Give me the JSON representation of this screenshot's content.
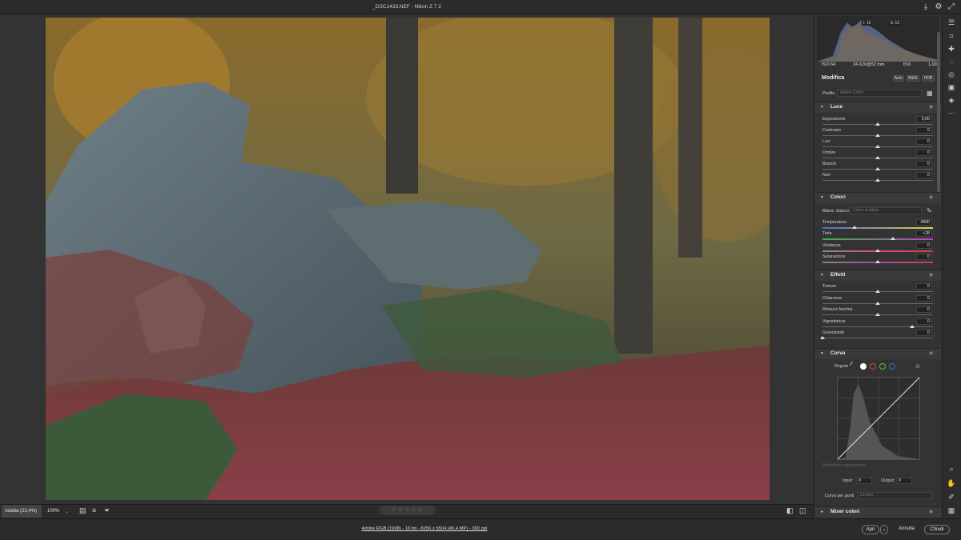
{
  "window": {
    "title": "_DSC1433.NEF  -  Nikon Z 7 2"
  },
  "histogram": {
    "labels": [
      "i: 16",
      "b: 12"
    ]
  },
  "camera": {
    "iso": "ISO 64",
    "lens": "24-120@52 mm",
    "aperture": "f/16",
    "shutter": "1,00s"
  },
  "edit": {
    "title": "Modifica",
    "buttons": [
      "Auto",
      "B&W",
      "HDR"
    ],
    "profile_label": "Profilo",
    "profile_value": "Adobe Colori"
  },
  "light": {
    "title": "Luce",
    "sliders": [
      {
        "label": "Esposizione",
        "value": "0,00"
      },
      {
        "label": "Contrasto",
        "value": "0"
      },
      {
        "label": "Luci",
        "value": "0"
      },
      {
        "label": "Ombre",
        "value": "0"
      },
      {
        "label": "Bianchi",
        "value": "0"
      },
      {
        "label": "Neri",
        "value": "0"
      }
    ]
  },
  "colors": {
    "title": "Colori",
    "wb_label": "Bilanc. bianco",
    "wb_value": "Come scattata",
    "sliders": [
      {
        "label": "Temperatura",
        "value": "4900"
      },
      {
        "label": "Tinta",
        "value": "+28"
      },
      {
        "label": "Vividezza",
        "value": "0"
      },
      {
        "label": "Saturazione",
        "value": "0"
      }
    ]
  },
  "effects": {
    "title": "Effetti",
    "sliders": [
      {
        "label": "Texture",
        "value": "0"
      },
      {
        "label": "Chiarezza",
        "value": "0"
      },
      {
        "label": "Rimuovi foschia",
        "value": "0"
      },
      {
        "label": "Vignettatura",
        "value": "0"
      },
      {
        "label": "Granulosità",
        "value": "0"
      }
    ]
  },
  "curve": {
    "title": "Curva",
    "regola_label": "Regola",
    "refine_label": "Perfeziona saturazione",
    "input_label": "Input:",
    "input_value": "0",
    "output_label": "Output:",
    "output_value": "0",
    "point_label": "Curva per punti",
    "point_value": "Lineare"
  },
  "mixer": {
    "title": "Mixer colori"
  },
  "bottom": {
    "zoom_fit": "Adatta (23,4%)",
    "zoom_100": "100%",
    "rating": "☆☆☆☆☆"
  },
  "status": {
    "meta": "Adobe RGB (1998) - 16 bit - 8256 x 5504 (45,4 MP) - 300 ppi",
    "open": "Apri",
    "cancel": "Annulla",
    "close": "Chiudi"
  },
  "colors_accent": {
    "panel": "#333333",
    "header": "#3a3a3a",
    "bg": "#1f1f1f"
  }
}
